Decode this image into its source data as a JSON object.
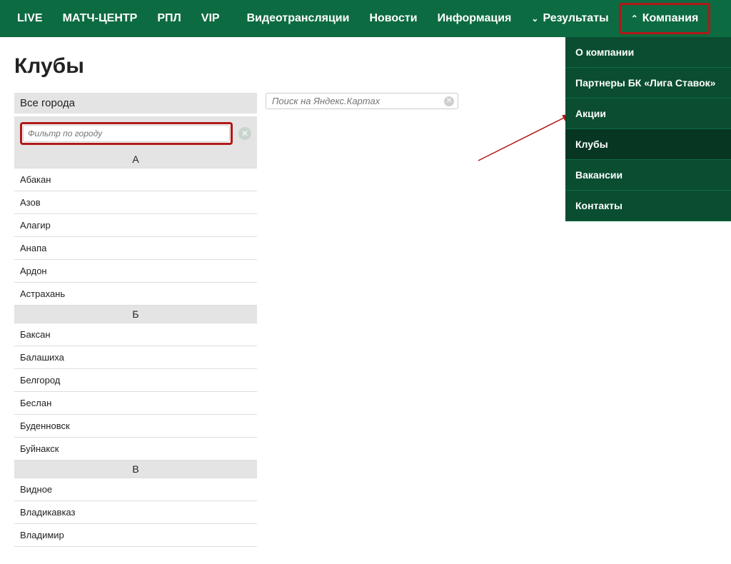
{
  "nav": {
    "items": [
      {
        "label": "LIVE"
      },
      {
        "label": "МАТЧ-ЦЕНТР"
      },
      {
        "label": "РПЛ"
      },
      {
        "label": "VIP"
      },
      {
        "label": "Видеотрансляции"
      },
      {
        "label": "Новости"
      },
      {
        "label": "Информация"
      },
      {
        "label": "Результаты",
        "chevron": true
      },
      {
        "label": "Компания",
        "chevron_up": true,
        "highlighted": true
      }
    ]
  },
  "dropdown": {
    "items": [
      {
        "label": "О компании"
      },
      {
        "label": "Партнеры БК «Лига Ставок»"
      },
      {
        "label": "Акции"
      },
      {
        "label": "Клубы",
        "active": true
      },
      {
        "label": "Вакансии"
      },
      {
        "label": "Контакты"
      }
    ]
  },
  "page": {
    "title": "Клубы"
  },
  "city_panel": {
    "all_label": "Все города",
    "filter_placeholder": "Фильтр по городу",
    "sections": [
      {
        "letter": "А",
        "cities": [
          "Абакан",
          "Азов",
          "Алагир",
          "Анапа",
          "Ардон",
          "Астрахань"
        ]
      },
      {
        "letter": "Б",
        "cities": [
          "Баксан",
          "Балашиха",
          "Белгород",
          "Беслан",
          "Буденновск",
          "Буйнакск"
        ]
      },
      {
        "letter": "В",
        "cities": [
          "Видное",
          "Владикавказ",
          "Владимир"
        ]
      }
    ]
  },
  "map": {
    "search_placeholder": "Поиск на Яндекс.Картах"
  }
}
